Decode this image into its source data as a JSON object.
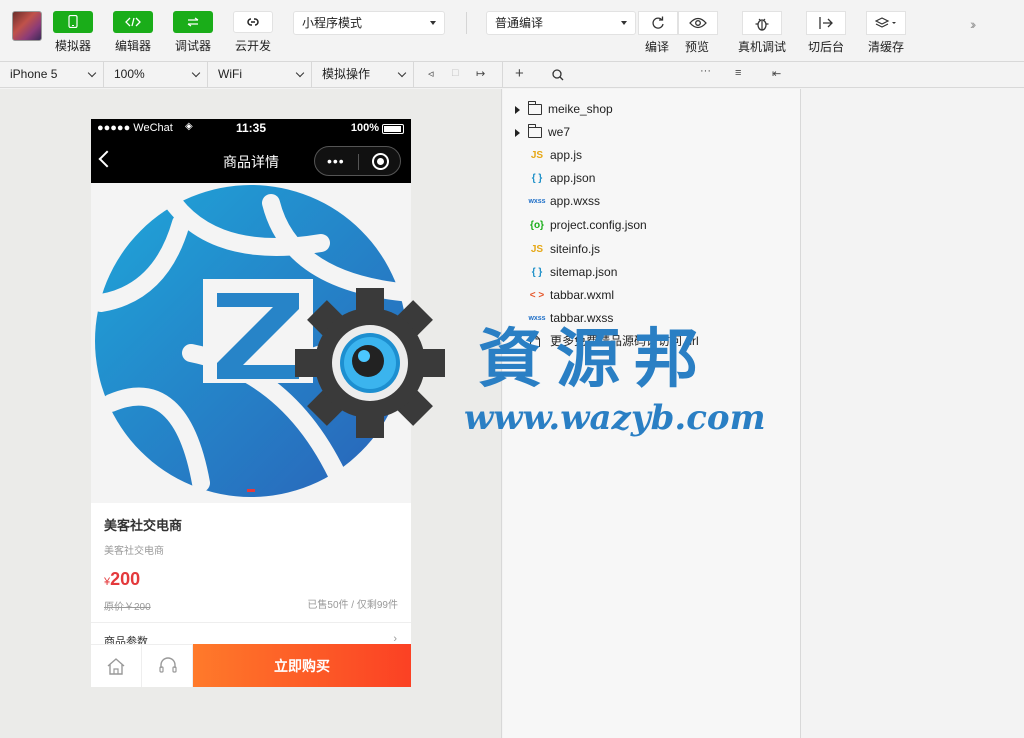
{
  "toolbar": {
    "simulator_label": "模拟器",
    "editor_label": "编辑器",
    "debugger_label": "调试器",
    "cloud_label": "云开发",
    "mode_select": "小程序模式",
    "compile_select": "普通编译",
    "compile_label": "编译",
    "preview_label": "预览",
    "remote_debug_label": "真机调试",
    "background_label": "切后台",
    "clear_cache_label": "清缓存",
    "accent_color": "#1aad19"
  },
  "subbar": {
    "device": "iPhone 5",
    "zoom": "100%",
    "network": "WiFi",
    "operation": "模拟操作"
  },
  "phone": {
    "carrier": "●●●●● WeChat",
    "time": "11:35",
    "battery": "100%",
    "nav_title": "商品详情",
    "capsule_dots": "•••",
    "product_name": "美客社交电商",
    "product_sub": "美客社交电商",
    "price_symbol": "¥",
    "price": "200",
    "original_price": "原价￥200",
    "sold_info": "已售50件 / 仅剩99件",
    "params_label": "商品参数",
    "buy_label": "立即购买",
    "price_color": "#e4393c"
  },
  "file_tree": [
    {
      "type": "folder",
      "name": "meike_shop"
    },
    {
      "type": "folder",
      "name": "we7"
    },
    {
      "type": "js",
      "icon": "JS",
      "name": "app.js",
      "color": "#e6a817"
    },
    {
      "type": "json",
      "icon": "{ }",
      "name": "app.json",
      "color": "#1e90c8"
    },
    {
      "type": "wxss",
      "icon": "wxss",
      "name": "app.wxss",
      "color": "#1e6fc8"
    },
    {
      "type": "config",
      "icon": "{o}",
      "name": "project.config.json",
      "color": "#1aad19"
    },
    {
      "type": "js",
      "icon": "JS",
      "name": "siteinfo.js",
      "color": "#e6a817"
    },
    {
      "type": "json",
      "icon": "{ }",
      "name": "sitemap.json",
      "color": "#1e90c8"
    },
    {
      "type": "wxml",
      "icon": "< >",
      "name": "tabbar.wxml",
      "color": "#e5572b"
    },
    {
      "type": "wxss",
      "icon": "wxss",
      "name": "tabbar.wxss",
      "color": "#1e6fc8"
    },
    {
      "type": "file",
      "icon": "",
      "name": "更多免费精品源码请访问.url",
      "color": "#333333"
    }
  ],
  "watermark": {
    "title": "資源邦",
    "url": "www.wazyb.com"
  }
}
